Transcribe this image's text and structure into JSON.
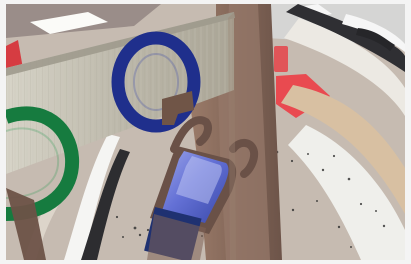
{
  "scene": {
    "colors": {
      "mat": "#c9bcb1",
      "mat_shadow": "#b8aca3",
      "mat_dark_band": "#2f2f33",
      "mat_light_band": "#f1f0ec",
      "mat_tan_band": "#d8c0a2",
      "wood_panel": "#bdb9aa",
      "wood_panel_dark": "#7d776b",
      "wood_post": "#8b6c5c",
      "wood_post_dark": "#6d5449",
      "ring_blue": "#1f2f8c",
      "ring_green": "#167b3f",
      "red_marker": "#d63c42",
      "blue_bin": "#4e5ec8",
      "blue_bin_light": "#8e98e1",
      "white_tile": "#fbfbf8"
    }
  }
}
